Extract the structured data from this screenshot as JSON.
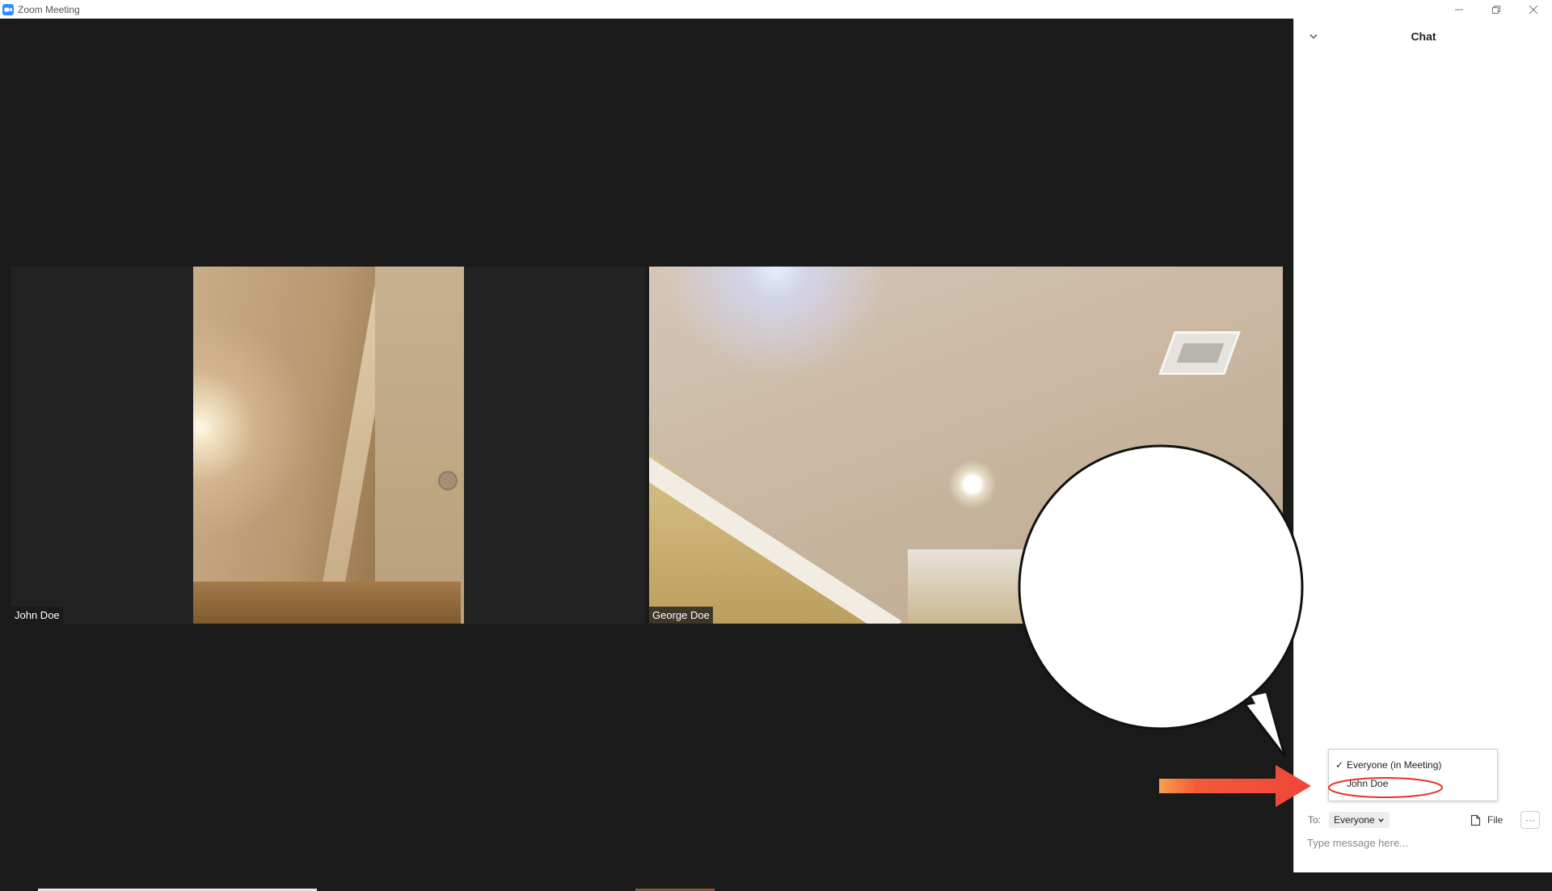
{
  "window": {
    "title": "Zoom Meeting",
    "icon": "zoom-camera-icon",
    "controls": [
      "minimize-icon",
      "restore-icon",
      "close-icon"
    ]
  },
  "participants": [
    {
      "name": "John Doe"
    },
    {
      "name": "George Doe"
    }
  ],
  "chat": {
    "title": "Chat",
    "to_label": "To:",
    "recipient": "Everyone",
    "file_label": "File",
    "more_label": "···",
    "input_placeholder": "Type message here..."
  },
  "recipient_dropdown": {
    "options": [
      {
        "label": "Everyone (in Meeting)",
        "checked": true
      },
      {
        "label": "John Doe",
        "checked": false,
        "highlighted": true
      }
    ]
  },
  "annotation": {
    "arrow_color": "#f0453a",
    "circle_color": "#e8322a",
    "bubble_text": ""
  },
  "colors": {
    "video_bg": "#1a1a1a",
    "tile_bg": "#222222",
    "panel_bg": "#ffffff",
    "accent": "#2d8cff"
  }
}
